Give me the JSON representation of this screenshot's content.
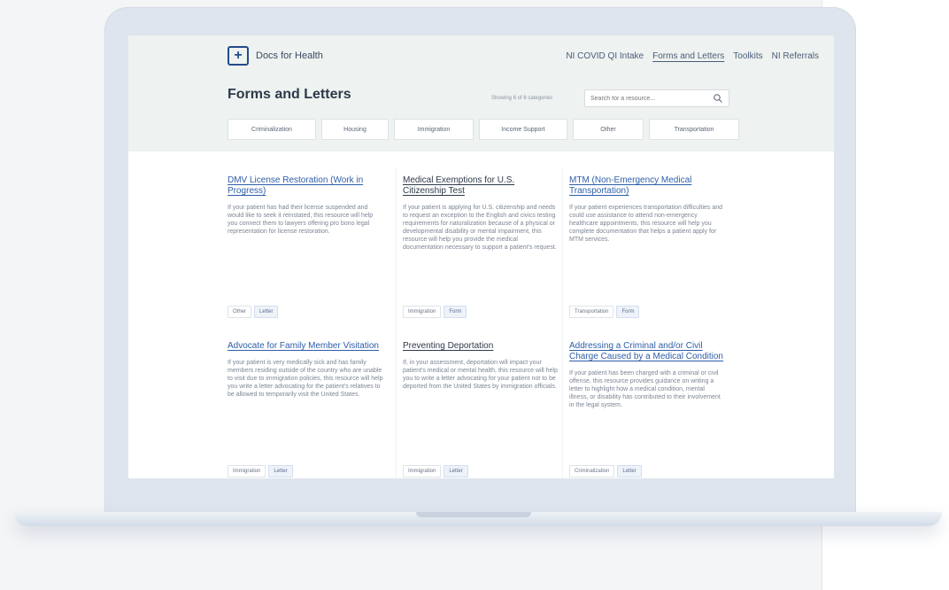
{
  "brand": {
    "name": "Docs for Health"
  },
  "nav": [
    {
      "label": "NI COVID QI Intake",
      "active": false
    },
    {
      "label": "Forms and Letters",
      "active": true
    },
    {
      "label": "Toolkits",
      "active": false
    },
    {
      "label": "NI Referrals",
      "active": false
    }
  ],
  "page": {
    "title": "Forms and Letters",
    "showing": "Showing 6 of 6 categories"
  },
  "search": {
    "placeholder": "Search for a resource..."
  },
  "categories": [
    "Criminalization",
    "Housing",
    "Immigration",
    "Income Support",
    "Other",
    "Transportation"
  ],
  "cards": [
    {
      "title": "DMV License Restoration (Work in Progress)",
      "description": "If your patient has had their license suspended and would like to seek it reinstated, this resource will help you connect them to lawyers offering pro bono legal representation for license restoration.",
      "tags": [
        "Other",
        "Letter"
      ]
    },
    {
      "title": "Medical Exemptions for U.S. Citizenship Test",
      "description": "If your patient is applying for U.S. citizenship and needs to request an exception to the English and civics testing requirements for naturalization because of a physical or developmental disability or mental impairment, this resource will help you provide the medical documentation necessary to support a patient's request.",
      "tags": [
        "Immigration",
        "Form"
      ]
    },
    {
      "title": "MTM (Non-Emergency Medical Transportation)",
      "description": "If your patient experiences transportation difficulties and could use assistance to attend non-emergency healthcare appointments, this resource will help you complete documentation that helps a patient apply for MTM services.",
      "tags": [
        "Transportation",
        "Form"
      ]
    },
    {
      "title": "Advocate for Family Member Visitation",
      "description": "If your patient is very medically sick and has family members residing outside of the country who are unable to visit due to immigration policies, this resource will help you write a letter advocating for the patient's relatives to be allowed to temporarily visit the United States.",
      "tags": [
        "Immigration",
        "Letter"
      ]
    },
    {
      "title": "Preventing Deportation",
      "description": "If, in your assessment, deportation will impact your patient's medical or mental health, this resource will help you to write a letter advocating for your patient not to be deported from the United States by immigration officials.",
      "tags": [
        "Immigration",
        "Letter"
      ]
    },
    {
      "title": "Addressing a Criminal and/or Civil Charge Caused by a Medical Condition",
      "description": "If your patient has been charged with a criminal or civil offense, this resource provides guidance on writing a letter to highlight how a medical condition, mental illness, or disability has contributed to their involvement in the legal system.",
      "tags": [
        "Criminalization",
        "Letter"
      ]
    }
  ]
}
